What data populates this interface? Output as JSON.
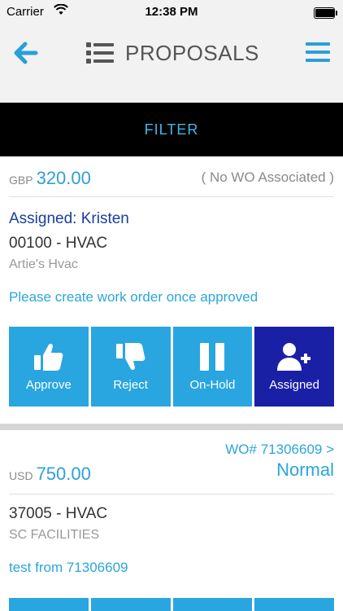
{
  "status_bar": {
    "carrier": "Carrier",
    "time": "12:38 PM",
    "battery_level": 0.95
  },
  "nav": {
    "title": "PROPOSALS"
  },
  "filter": {
    "label": "FILTER"
  },
  "proposals": [
    {
      "currency": "GBP",
      "amount": "320.00",
      "wo_label": "( No WO Associated )",
      "assigned": "Assigned: Kristen",
      "code": "00100 - HVAC",
      "company": "Artie's Hvac",
      "note": "Please create work order once approved",
      "actions": [
        {
          "label": "Approve",
          "icon": "thumbs-up-icon"
        },
        {
          "label": "Reject",
          "icon": "thumbs-down-icon"
        },
        {
          "label": "On-Hold",
          "icon": "pause-icon"
        },
        {
          "label": "Assigned",
          "icon": "add-user-icon",
          "active": true
        }
      ]
    },
    {
      "currency": "USD",
      "amount": "750.00",
      "wo_label": "WO# 71306609 >",
      "priority": "Normal",
      "code": "37005 - HVAC",
      "company": "SC FACILITIES",
      "note": "test from 71306609"
    }
  ],
  "colors": {
    "accent": "#29a6e0",
    "assigned_active": "#1a20a6",
    "assigned_text": "#1a3d9e",
    "filter_bg": "#000000",
    "filter_text": "#45b6e8"
  }
}
